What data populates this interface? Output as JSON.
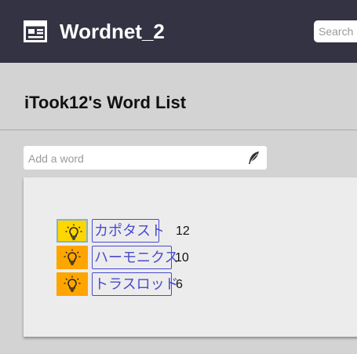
{
  "app": {
    "title": "Wordnet_2"
  },
  "search": {
    "placeholder": "Search"
  },
  "page": {
    "heading": "iTook12's Word List"
  },
  "add_word": {
    "placeholder": "Add a word"
  },
  "words": [
    {
      "text": "カポタスト",
      "count": "12",
      "bulb_color": "#ffd700",
      "active": true
    },
    {
      "text": "ハーモニクス",
      "count": "10",
      "bulb_color": "#ffa500",
      "active": false
    },
    {
      "text": "トラスロッド",
      "count": "6",
      "bulb_color": "#ffa500",
      "active": false
    }
  ],
  "colors": {
    "topbar": "#343343",
    "link": "#4a4ad0",
    "bulb_active": "#ffd700",
    "bulb_default": "#ffa500"
  },
  "icons": {
    "logo": "newspaper-icon",
    "add": "feather-icon",
    "word_action": "lightbulb-icon"
  }
}
